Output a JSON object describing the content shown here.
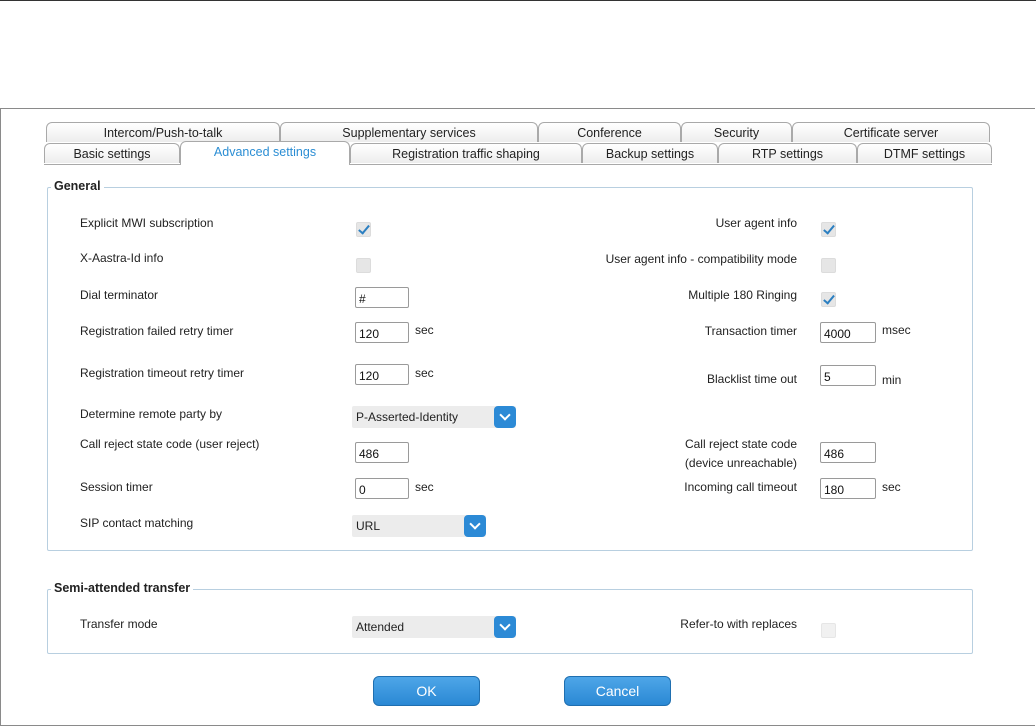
{
  "tabs_row1": [
    "Intercom/Push-to-talk",
    "Supplementary services",
    "Conference",
    "Security",
    "Certificate server"
  ],
  "tabs_row2": [
    "Basic settings",
    "Advanced settings",
    "Registration traffic shaping",
    "Backup settings",
    "RTP settings",
    "DTMF settings"
  ],
  "active_tab": "Advanced settings",
  "general": {
    "legend": "General",
    "explicit_mwi": {
      "label": "Explicit MWI subscription",
      "checked": true
    },
    "x_aastra": {
      "label": "X-Aastra-Id info",
      "checked": false
    },
    "dial_terminator": {
      "label": "Dial terminator",
      "value": "#"
    },
    "reg_failed": {
      "label": "Registration failed retry timer",
      "value": "120",
      "unit": "sec"
    },
    "reg_timeout": {
      "label": "Registration timeout retry timer",
      "value": "120",
      "unit": "sec"
    },
    "remote_party": {
      "label": "Determine remote party by",
      "value": "P-Asserted-Identity"
    },
    "call_reject_user": {
      "label": "Call reject state code (user reject)",
      "value": "486"
    },
    "session_timer": {
      "label": "Session timer",
      "value": "0",
      "unit": "sec"
    },
    "sip_contact": {
      "label": "SIP contact matching",
      "value": "URL"
    },
    "user_agent": {
      "label": "User agent info",
      "checked": true
    },
    "user_agent_compat": {
      "label": "User agent info - compatibility mode",
      "checked": false
    },
    "multiple_180": {
      "label": "Multiple 180 Ringing",
      "checked": true
    },
    "transaction_timer": {
      "label": "Transaction timer",
      "value": "4000",
      "unit": "msec"
    },
    "blacklist": {
      "label": "Blacklist time out",
      "value": "5",
      "unit": "min"
    },
    "call_reject_device": {
      "label_line1": "Call reject state code",
      "label_line2": "(device unreachable)",
      "value": "486"
    },
    "incoming_timeout": {
      "label": "Incoming call timeout",
      "value": "180",
      "unit": "sec"
    }
  },
  "semi": {
    "legend": "Semi-attended transfer",
    "transfer_mode": {
      "label": "Transfer mode",
      "value": "Attended"
    },
    "refer_to": {
      "label": "Refer-to with replaces",
      "checked": false
    }
  },
  "buttons": {
    "ok": "OK",
    "cancel": "Cancel"
  },
  "icons": {
    "dropdown": "chevron-down-icon",
    "check": "checkmark-icon"
  },
  "colors": {
    "accent": "#2c8ad6",
    "active_tab_text": "#2b8ed4",
    "group_border": "#b8cfe0"
  }
}
